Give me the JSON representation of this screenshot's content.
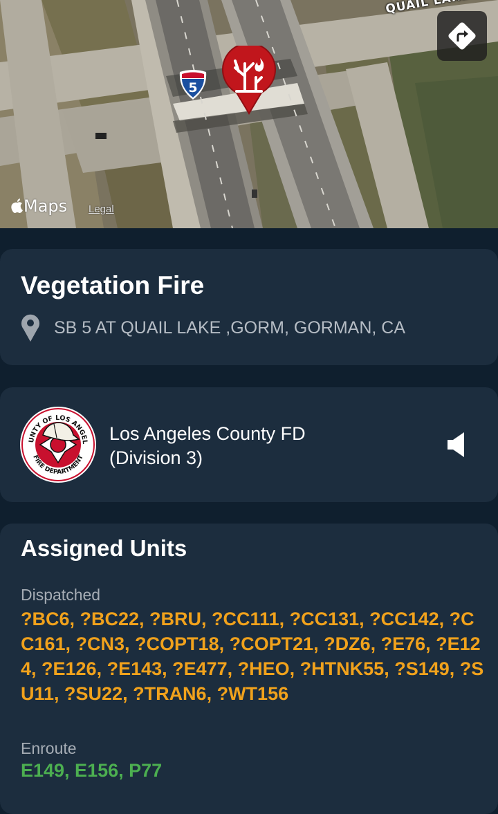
{
  "map": {
    "road_label": "QUAIL LAKE R",
    "shield_number": "5",
    "attribution": "Maps",
    "legal": "Legal",
    "directions_icon": "directions-turn-icon",
    "pin_icon": "vegetation-fire-pin-icon"
  },
  "incident": {
    "title": "Vegetation Fire",
    "address": "SB 5 AT QUAIL LAKE ,GORM, GORMAN, CA",
    "location_icon": "location-pin-icon"
  },
  "agency": {
    "name_line1": "Los Angeles County FD",
    "name_line2": "(Division 3)",
    "logo_top_text": "COUNTY OF LOS ANGELES",
    "logo_bottom_text": "FIRE DEPARTMENT",
    "speaker_icon": "speaker-icon"
  },
  "units": {
    "title": "Assigned Units",
    "dispatched_label": "Dispatched",
    "dispatched": "?BC6, ?BC22, ?BRU, ?CC111, ?CC131, ?CC142, ?CC161, ?CN3, ?COPT18, ?COPT21, ?DZ6, ?E76, ?E124, ?E126, ?E143, ?E477, ?HEO, ?HTNK55, ?S149, ?SU11, ?SU22, ?TRAN6, ?WT156",
    "enroute_label": "Enroute",
    "enroute": "E149, E156, P77"
  },
  "colors": {
    "background": "#0f1f2e",
    "card": "#1c2d3e",
    "dispatched": "#f1a21c",
    "enroute": "#4caf50",
    "pin": "#c1161c"
  }
}
